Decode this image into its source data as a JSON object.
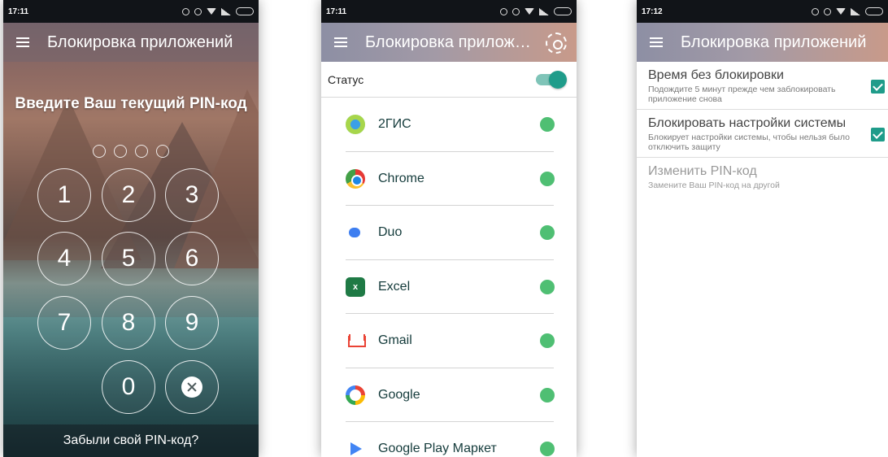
{
  "phones": [
    {
      "time": "17:11",
      "title": "Блокировка приложений",
      "pin_title": "Введите Ваш текущий PIN-код",
      "keys": [
        "1",
        "2",
        "3",
        "4",
        "5",
        "6",
        "7",
        "8",
        "9",
        "0"
      ],
      "forgot_label": "Забыли свой PIN-код?"
    },
    {
      "time": "17:11",
      "title": "Блокировка приложений",
      "status_label": "Статус",
      "apps": [
        {
          "name": "2ГИС",
          "icon": "2gis-icon"
        },
        {
          "name": "Chrome",
          "icon": "chrome-icon"
        },
        {
          "name": "Duo",
          "icon": "duo-icon"
        },
        {
          "name": "Excel",
          "icon": "excel-icon",
          "glyph": "x"
        },
        {
          "name": "Gmail",
          "icon": "gmail-icon"
        },
        {
          "name": "Google",
          "icon": "google-icon"
        },
        {
          "name": "Google Play Маркет",
          "icon": "google-play-icon"
        }
      ]
    },
    {
      "time": "17:12",
      "title": "Блокировка приложений",
      "settings": [
        {
          "title": "Время без блокировки",
          "desc": "Подождите 5 минут прежде чем заблокировать приложение снова",
          "checked": true
        },
        {
          "title": "Блокировать настройки системы",
          "desc": "Блокирует настройки системы, чтобы нельзя было отключить защиту",
          "checked": true
        },
        {
          "title": "Изменить PIN-код",
          "desc": "Замените Ваш PIN-код на другой",
          "checked": null
        }
      ]
    }
  ],
  "colors": {
    "accent": "#1f9c8a",
    "status_green": "#4fbf73",
    "app_text": "#143b3b"
  }
}
